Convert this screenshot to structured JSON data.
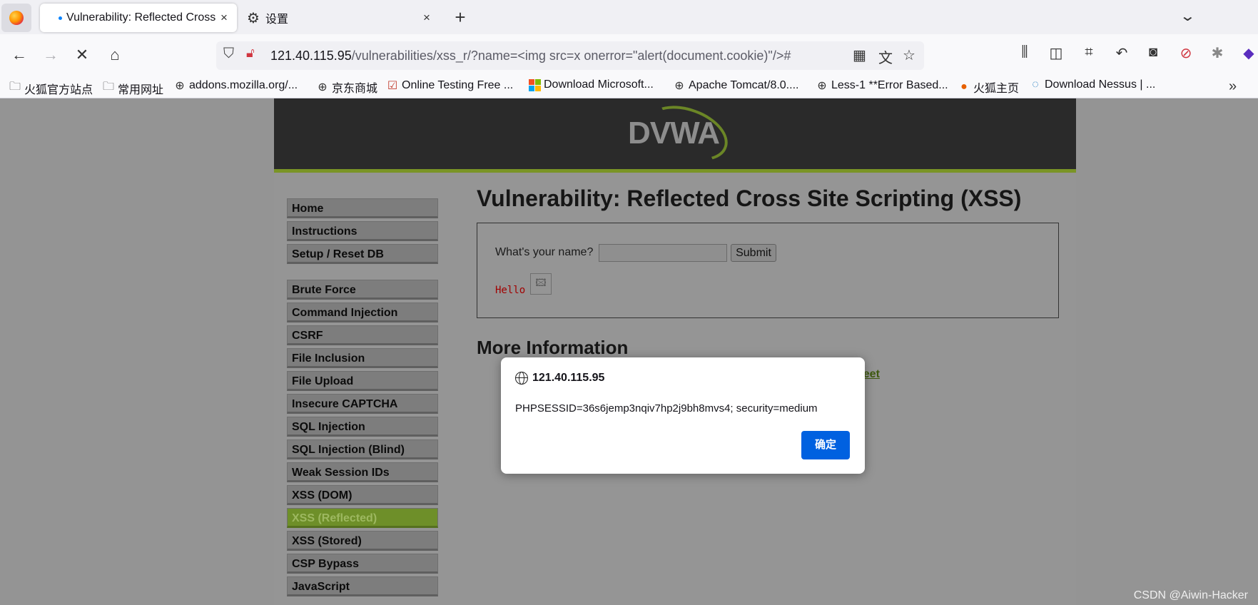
{
  "browser": {
    "tabs": [
      {
        "title": "Vulnerability: Reflected Cross",
        "close": "×"
      },
      {
        "title": "设置",
        "close": "×"
      }
    ],
    "new_tab": "+",
    "url_host": "121.40.115.95",
    "url_path": "/vulnerabilities/xss_r/?name=<img src=x onerror=\"alert(document.cookie)\"/>#",
    "bookmarks": [
      {
        "label": "火狐官方站点",
        "icon": "folder-icon"
      },
      {
        "label": "常用网址",
        "icon": "folder-icon"
      },
      {
        "label": "addons.mozilla.org/...",
        "icon": "globe-icon"
      },
      {
        "label": "京东商城",
        "icon": "globe-icon"
      },
      {
        "label": "Online Testing Free ...",
        "icon": "checkbox-icon"
      },
      {
        "label": "Download Microsoft...",
        "icon": "microsoft-icon"
      },
      {
        "label": "Apache Tomcat/8.0....",
        "icon": "globe-icon"
      },
      {
        "label": "Less-1 **Error Based...",
        "icon": "globe-icon"
      },
      {
        "label": "火狐主页",
        "icon": "firefox-icon"
      },
      {
        "label": "Download Nessus | ...",
        "icon": "nessus-icon"
      }
    ]
  },
  "page": {
    "logo": "DVWA",
    "menu": [
      "Home",
      "Instructions",
      "Setup / Reset DB",
      "Brute Force",
      "Command Injection",
      "CSRF",
      "File Inclusion",
      "File Upload",
      "Insecure CAPTCHA",
      "SQL Injection",
      "SQL Injection (Blind)",
      "Weak Session IDs",
      "XSS (DOM)",
      "XSS (Reflected)",
      "XSS (Stored)",
      "CSP Bypass",
      "JavaScript"
    ],
    "active_menu": "XSS (Reflected)",
    "title": "Vulnerability: Reflected Cross Site Scripting (XSS)",
    "form": {
      "question": "What's your name?",
      "input_value": "",
      "submit": "Submit"
    },
    "hello": "Hello",
    "more_info": "More Information",
    "link_fragment": "heet"
  },
  "dialog": {
    "origin": "121.40.115.95",
    "message": "PHPSESSID=36s6jemp3nqiv7hp2j9bh8mvs4; security=medium",
    "ok": "确定"
  },
  "watermark": "CSDN @Aiwin-Hacker",
  "colors": {
    "accent": "#0061e0",
    "dvwa_green": "#7a9426",
    "active_menu": "#6e8f29"
  }
}
